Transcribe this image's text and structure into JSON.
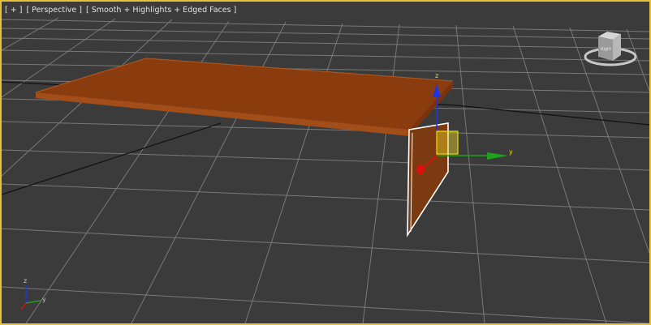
{
  "viewport": {
    "label_plus": "[ + ]",
    "label_view": "[ Perspective ]",
    "label_shading": "[ Smooth + Highlights + Edged Faces ]",
    "active_border_color": "#e6c23a",
    "background_color": "#3b3b3b",
    "grid_color": "#7d7d7d"
  },
  "gizmo": {
    "x_label": "x",
    "y_label": "y",
    "z_label": "z"
  },
  "viewcube": {
    "face_label": "Right"
  },
  "axis_tripod": {
    "x_label": "x",
    "y_label": "y",
    "z_label": "z"
  },
  "colors": {
    "box_top": "#8a3c0f",
    "box_front": "#a34d18",
    "selected_panel": "#7c3a10",
    "axis_x": "#e01010",
    "axis_y": "#1ea21e",
    "axis_z": "#1d35e0"
  }
}
